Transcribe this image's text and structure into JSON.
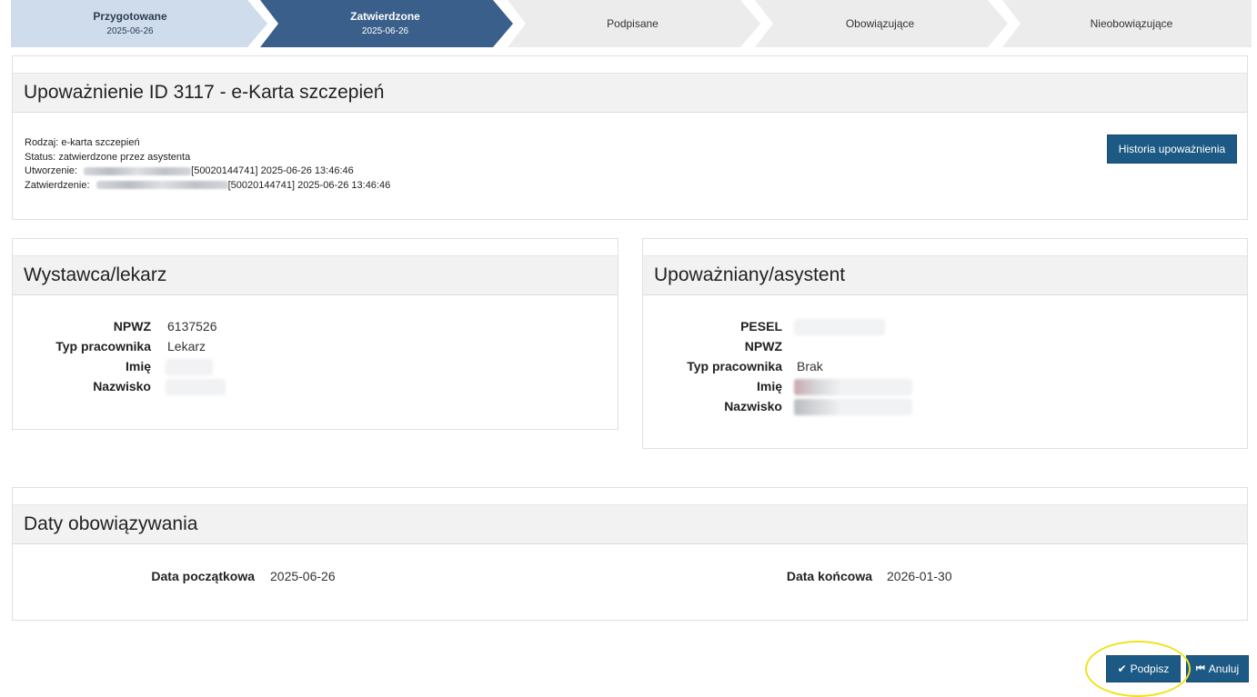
{
  "steps": [
    {
      "title": "Przygotowane",
      "date": "2025-06-26",
      "state": "done"
    },
    {
      "title": "Zatwierdzone",
      "date": "2025-06-26",
      "state": "active"
    },
    {
      "title": "Podpisane",
      "date": "",
      "state": "todo"
    },
    {
      "title": "Obowiązujące",
      "date": "",
      "state": "todo"
    },
    {
      "title": "Nieobowiązujące",
      "date": "",
      "state": "todo"
    }
  ],
  "colors": {
    "step_done": "#cfdceb",
    "step_active": "#3a5f8a",
    "step_todo": "#ececec",
    "button": "#1c5a85",
    "highlight": "#f1e21a"
  },
  "main": {
    "title": "Upoważnienie ID 3117 - e-Karta szczepień",
    "rodzaj_label": "Rodzaj:",
    "rodzaj_value": "e-karta szczepień",
    "status_label": "Status:",
    "status_value": "zatwierdzone przez asystenta",
    "utworzenie_label": "Utworzenie:",
    "utworzenie_value": "[50020144741] 2025-06-26 13:46:46",
    "zatwierdzenie_label": "Zatwierdzenie:",
    "zatwierdzenie_value": "[50020144741] 2025-06-26 13:46:46",
    "history_button": "Historia upoważnienia"
  },
  "issuer": {
    "title": "Wystawca/lekarz",
    "npwz_label": "NPWZ",
    "npwz_value": "6137526",
    "type_label": "Typ pracownika",
    "type_value": "Lekarz",
    "name_label": "Imię",
    "surname_label": "Nazwisko"
  },
  "assistant": {
    "title": "Upoważniany/asystent",
    "pesel_label": "PESEL",
    "npwz_label": "NPWZ",
    "type_label": "Typ pracownika",
    "type_value": "Brak",
    "name_label": "Imię",
    "surname_label": "Nazwisko"
  },
  "dates": {
    "title": "Daty obowiązywania",
    "start_label": "Data początkowa",
    "start_value": "2025-06-26",
    "end_label": "Data końcowa",
    "end_value": "2026-01-30"
  },
  "actions": {
    "sign_icon": "check-icon",
    "sign_label": "Podpisz",
    "cancel_icon": "step-backward-icon",
    "cancel_label": "Anuluj"
  }
}
